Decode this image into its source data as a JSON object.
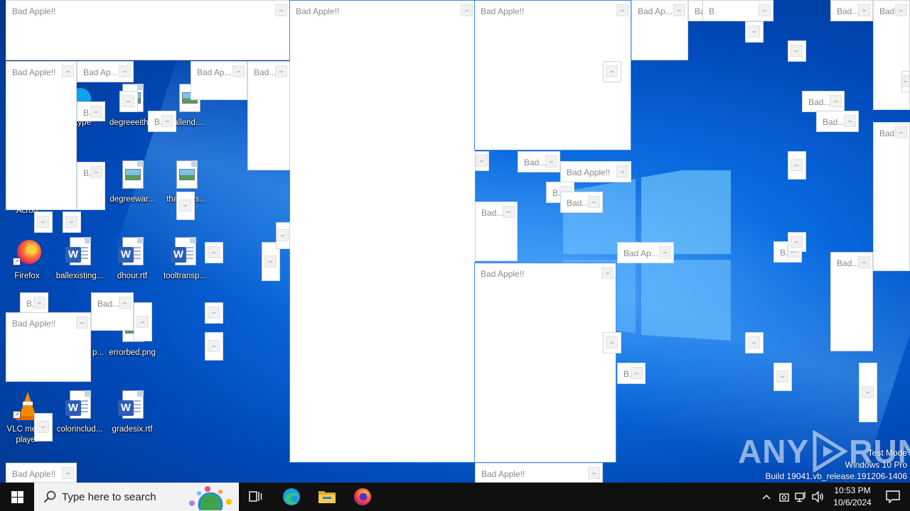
{
  "desktop": {
    "icons": [
      {
        "label": "Skype"
      },
      {
        "label": "degreeeith..."
      },
      {
        "label": "allend...."
      },
      {
        "label": "degreewar..."
      },
      {
        "label": "thanksps..."
      },
      {
        "label": "Acrob"
      },
      {
        "label": "Firefox"
      },
      {
        "label": "ballexisting..."
      },
      {
        "label": "dhour.rtf"
      },
      {
        "label": "tooltransp..."
      },
      {
        "label": "p..."
      },
      {
        "label": "errorbed.png"
      },
      {
        "label": "VLC media player"
      },
      {
        "label": "colorinclud..."
      },
      {
        "label": "gradesix.rtf"
      }
    ]
  },
  "popup_windows": {
    "titles": {
      "full": "Bad Apple!!",
      "medium": "Bad Ap...",
      "short": "Bad...",
      "tiny": "B...",
      "ba": "Ba",
      "b": "B"
    }
  },
  "watermark": {
    "brand": "ANY RUN",
    "brand_left": "ANY",
    "brand_right": "RUN",
    "mode": "Test Mode",
    "os": "Windows 10 Pro",
    "build": "Build 19041.vb_release.191206-1406"
  },
  "taskbar": {
    "search_placeholder": "Type here to search",
    "time": "10:53 PM",
    "date": "10/6/2024",
    "pinned": [
      "Task View",
      "Microsoft Edge",
      "File Explorer",
      "Firefox"
    ]
  }
}
